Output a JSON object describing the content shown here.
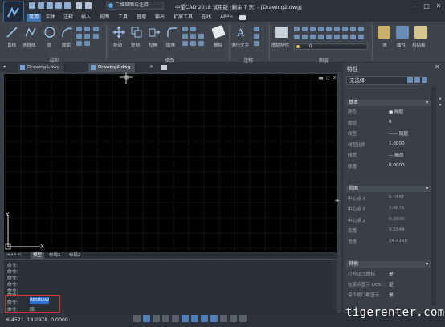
{
  "app": {
    "title": "中望CAD 2018 试用版 (剩余 7 天) - [Drawing2.dwg]",
    "workspace": "二维草图与注释",
    "window_buttons": [
      "—",
      "□",
      "✕"
    ]
  },
  "menu": {
    "items": [
      "常用",
      "实体",
      "注释",
      "插入",
      "视图",
      "工具",
      "管理",
      "输出",
      "扩展工具",
      "在线",
      "APP+"
    ],
    "active": "常用"
  },
  "ribbon": {
    "tools": {
      "line": "直线",
      "polyline": "多段线",
      "circle": "圆",
      "arc": "圆弧",
      "move": "移动",
      "copy": "复制",
      "stretch": "拉伸",
      "fillet": "圆角",
      "erase": "删除",
      "mtext": "多行文字",
      "layer_props": "图层特性",
      "block": "块",
      "properties": "属性",
      "clipboard": "剪贴板"
    },
    "groups": [
      "绘制",
      "修改",
      "注释",
      "图层"
    ],
    "layer_value": "0"
  },
  "doc_tabs": [
    "Drawing1.dwg",
    "Drawing2.dwg"
  ],
  "layout_tabs": [
    "模型",
    "布局1",
    "布局2"
  ],
  "ucs": {
    "x": "X",
    "y": "Y"
  },
  "command": {
    "lines": [
      "命令:",
      "命令:",
      "命令:",
      "命令:",
      "命令:",
      "命令:"
    ],
    "highlight_prefix": "命令:",
    "highlight_cmd": "REDRAW",
    "last_prefix": "命令:",
    "last_value": "回"
  },
  "status": {
    "coords": "6.4521, 18.2978, 0.0000"
  },
  "properties": {
    "title": "特性",
    "close": "✕",
    "selection": "无选择",
    "sections": {
      "basic": "基本",
      "view": "视图",
      "misc": "其他"
    },
    "basic": [
      {
        "key": "颜色",
        "value": "■ 随层"
      },
      {
        "key": "图层",
        "value": "0"
      },
      {
        "key": "线型",
        "value": "—— 随层"
      },
      {
        "key": "线型比例",
        "value": "1.0000"
      },
      {
        "key": "线宽",
        "value": "— 随层"
      },
      {
        "key": "厚度",
        "value": "0.0000"
      }
    ],
    "view": [
      {
        "key": "中心点 X",
        "value": "8.0181"
      },
      {
        "key": "中心点 Y",
        "value": "5.6875"
      },
      {
        "key": "中心点 Z",
        "value": "0.0000"
      },
      {
        "key": "高度",
        "value": "9.5544"
      },
      {
        "key": "宽度",
        "value": "24.4168"
      }
    ],
    "misc": [
      {
        "key": "打开UCS图标",
        "value": "是"
      },
      {
        "key": "在原点显示 UCS ...",
        "value": "是"
      },
      {
        "key": "每个视口都显示...",
        "value": "是"
      }
    ]
  },
  "watermark": "tigerenter.com",
  "colors": {
    "accent": "#3e74b4",
    "canvas": "#000000",
    "highlight_border": "#d23a3a",
    "redraw_bg": "#2c6fd6"
  }
}
